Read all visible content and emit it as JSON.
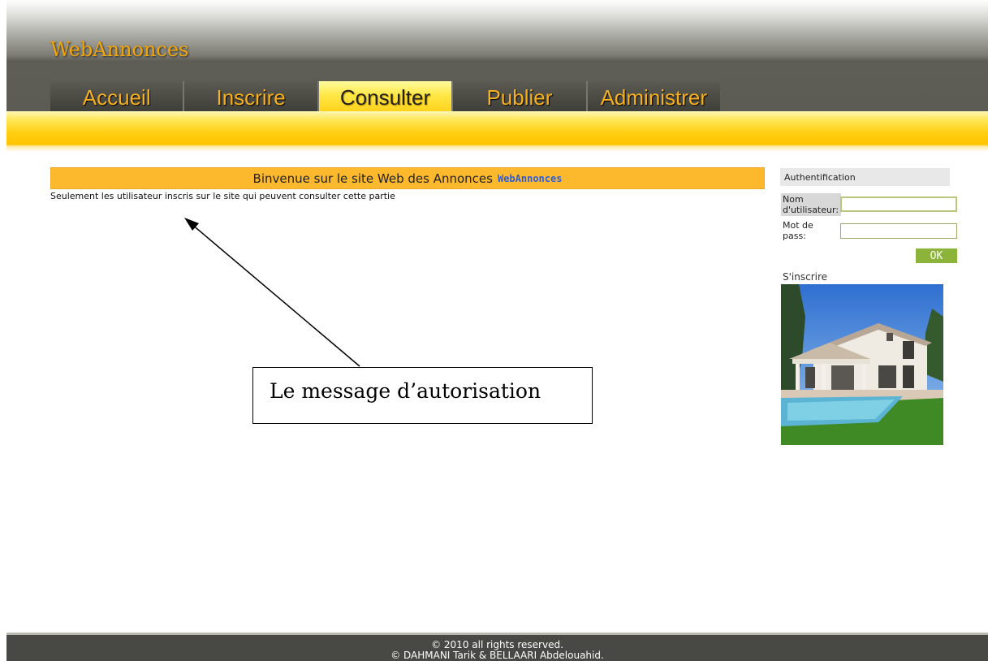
{
  "site": {
    "logo": "WebAnnonces"
  },
  "nav": {
    "items": [
      {
        "label": "Accueil"
      },
      {
        "label": "Inscrire"
      },
      {
        "label": "Consulter"
      },
      {
        "label": "Publier"
      },
      {
        "label": "Administrer"
      }
    ],
    "active": "Consulter"
  },
  "main": {
    "welcome_text": "Binvenue sur le site Web des Annonces",
    "welcome_brand": "WebAnnonces",
    "auth_message": "Seulement les utilisateur inscris sur le site qui peuvent consulter cette partie",
    "callout": "Le message d’autorisation"
  },
  "sidebar": {
    "auth_title": "Authentification",
    "username_label_line1": "Nom",
    "username_label_line2": "d'utilisateur:",
    "password_label_line1": "Mot de",
    "password_label_line2": "pass:",
    "username_value": "",
    "password_value": "",
    "ok_label": "OK",
    "signup_label": "S'inscrire"
  },
  "footer": {
    "line1": "© 2010 all rights reserved.",
    "line2": "© DAHMANI Tarik & BELLAARI Abdelouahid."
  },
  "colors": {
    "accent": "#fdb92e",
    "nav_text": "#f7b11e",
    "brand_link": "#2f5ed8",
    "ok_button": "#8cb33a",
    "footer_bg": "#484844"
  }
}
